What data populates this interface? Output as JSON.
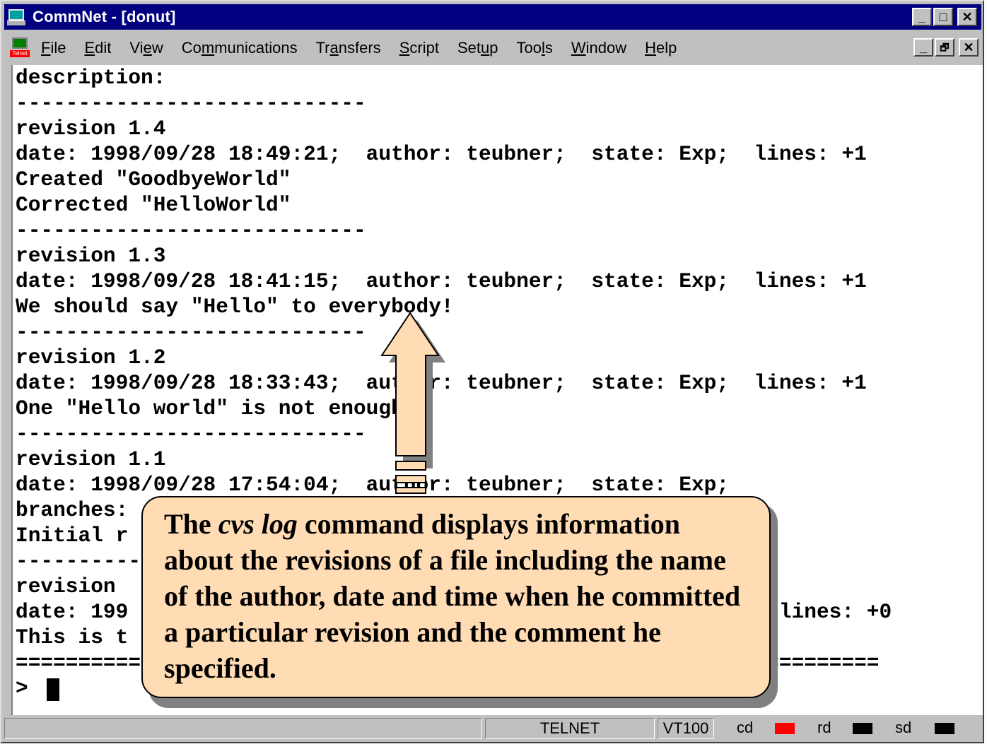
{
  "window": {
    "title": "CommNet - [donut]",
    "controls": {
      "minimize": "_",
      "maximize": "□",
      "close": "✕",
      "restore": "🗗"
    }
  },
  "menubar": {
    "items": [
      {
        "pre": "",
        "key": "F",
        "post": "ile"
      },
      {
        "pre": "",
        "key": "E",
        "post": "dit"
      },
      {
        "pre": "Vi",
        "key": "e",
        "post": "w"
      },
      {
        "pre": "Co",
        "key": "m",
        "post": "munications"
      },
      {
        "pre": "Tr",
        "key": "a",
        "post": "nsfers"
      },
      {
        "pre": "",
        "key": "S",
        "post": "cript"
      },
      {
        "pre": "Set",
        "key": "u",
        "post": "p"
      },
      {
        "pre": "Too",
        "key": "l",
        "post": "s"
      },
      {
        "pre": "",
        "key": "W",
        "post": "indow"
      },
      {
        "pre": "",
        "key": "H",
        "post": "elp"
      }
    ],
    "telnet_icon_label": "Telnet"
  },
  "terminal": {
    "lines": [
      "description:",
      "----------------------------",
      "revision 1.4",
      "date: 1998/09/28 18:49:21;  author: teubner;  state: Exp;  lines: +1",
      "Created \"GoodbyeWorld\"",
      "Corrected \"HelloWorld\"",
      "----------------------------",
      "revision 1.3",
      "date: 1998/09/28 18:41:15;  author: teubner;  state: Exp;  lines: +1",
      "We should say \"Hello\" to everybody!",
      "----------------------------",
      "revision 1.2",
      "date: 1998/09/28 18:33:43;  author: teubner;  state: Exp;  lines: +1",
      "One \"Hello world\" is not enough!",
      "----------------------------",
      "revision 1.1",
      "date: 1998/09/28 17:54:04;  author: teubner;  state: Exp;",
      "branches:",
      "Initial r",
      "----------",
      "revision",
      "date: 199                                                p;  lines: +0",
      "This is t",
      "=====================================================================",
      ">"
    ]
  },
  "callout": {
    "text_before": "The ",
    "text_italic": "cvs log",
    "text_after": " command displays information about the revisions of a file including the name of the author, date and time when he committed a particular revision and the comment he specified."
  },
  "statusbar": {
    "protocol": "TELNET",
    "emulation": "VT100",
    "cd_label": "cd",
    "rd_label": "rd",
    "sd_label": "sd",
    "cd_color": "#ff0000",
    "rd_color": "#000000",
    "sd_color": "#000000"
  }
}
